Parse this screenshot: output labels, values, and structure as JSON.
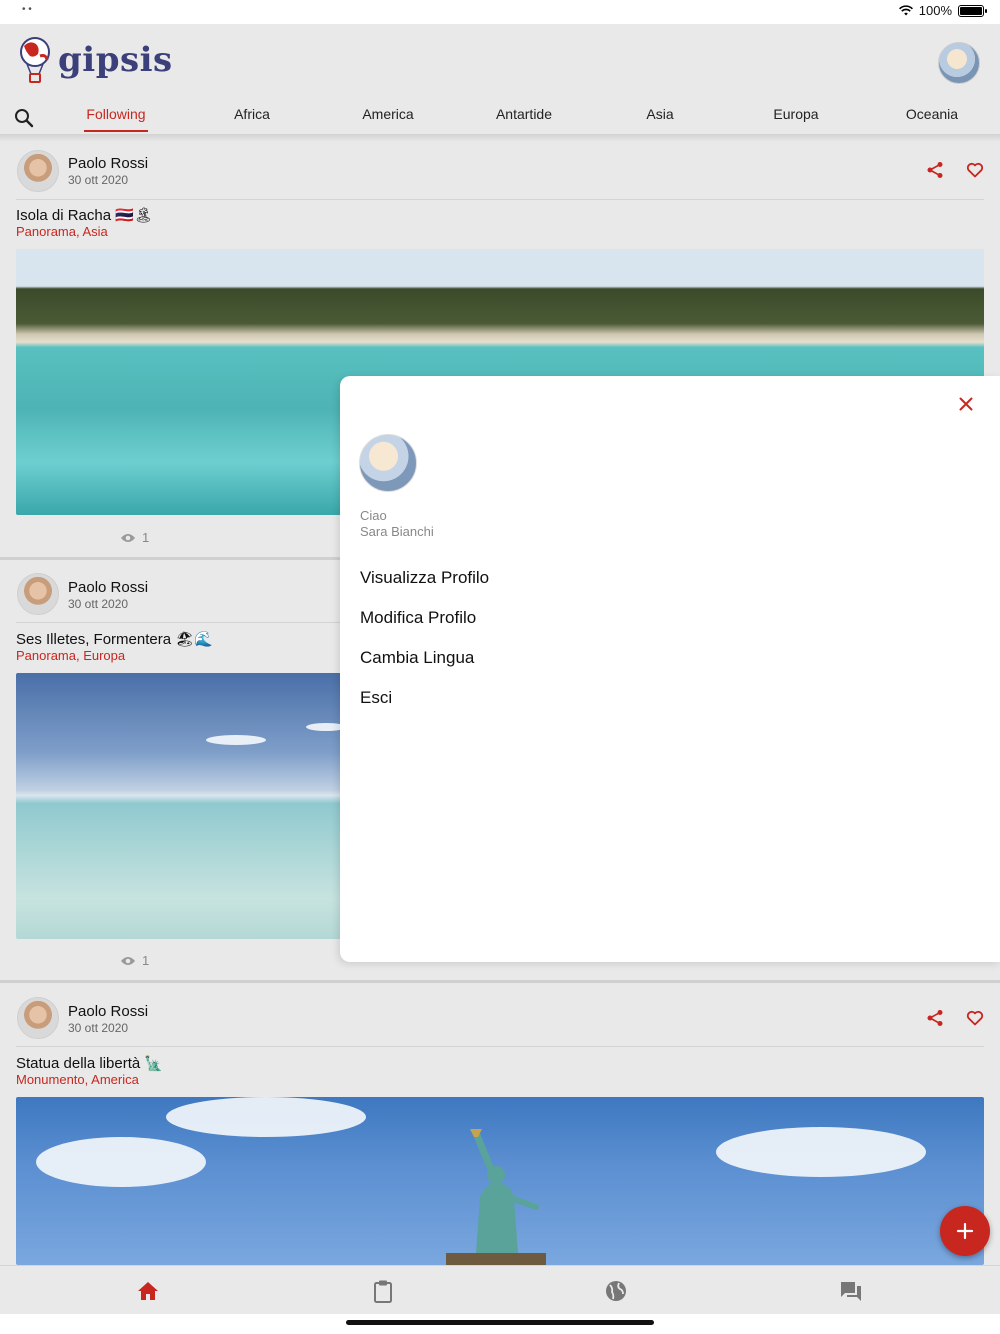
{
  "status_bar": {
    "battery": "100%"
  },
  "header": {
    "logo_text": "gipsis",
    "tabs": [
      {
        "label": "Following",
        "active": true
      },
      {
        "label": "Africa"
      },
      {
        "label": "America"
      },
      {
        "label": "Antartide"
      },
      {
        "label": "Asia"
      },
      {
        "label": "Europa"
      },
      {
        "label": "Oceania"
      }
    ]
  },
  "posts": [
    {
      "author": "Paolo Rossi",
      "date": "30 ott 2020",
      "title": "Isola di Racha 🇹🇭🏝",
      "category": "Panorama, Asia",
      "views": "1"
    },
    {
      "author": "Paolo Rossi",
      "date": "30 ott 2020",
      "title": "Ses Illetes, Formentera 🏖🌊",
      "category": "Panorama, Europa",
      "views": "1"
    },
    {
      "author": "Paolo Rossi",
      "date": "30 ott 2020",
      "title": "Statua della libertà 🗽",
      "category": "Monumento, America"
    }
  ],
  "drawer": {
    "greeting": "Ciao",
    "user_name": "Sara Bianchi",
    "menu": [
      {
        "label": "Visualizza Profilo"
      },
      {
        "label": "Modifica Profilo"
      },
      {
        "label": "Cambia Lingua"
      },
      {
        "label": "Esci"
      }
    ]
  },
  "bottom_nav": [
    {
      "icon": "home-icon",
      "active": true
    },
    {
      "icon": "clipboard-icon"
    },
    {
      "icon": "globe-icon"
    },
    {
      "icon": "chat-icon"
    }
  ],
  "colors": {
    "accent": "#c7271f",
    "logo": "#3b3f7a",
    "background": "#e9e9e9"
  }
}
